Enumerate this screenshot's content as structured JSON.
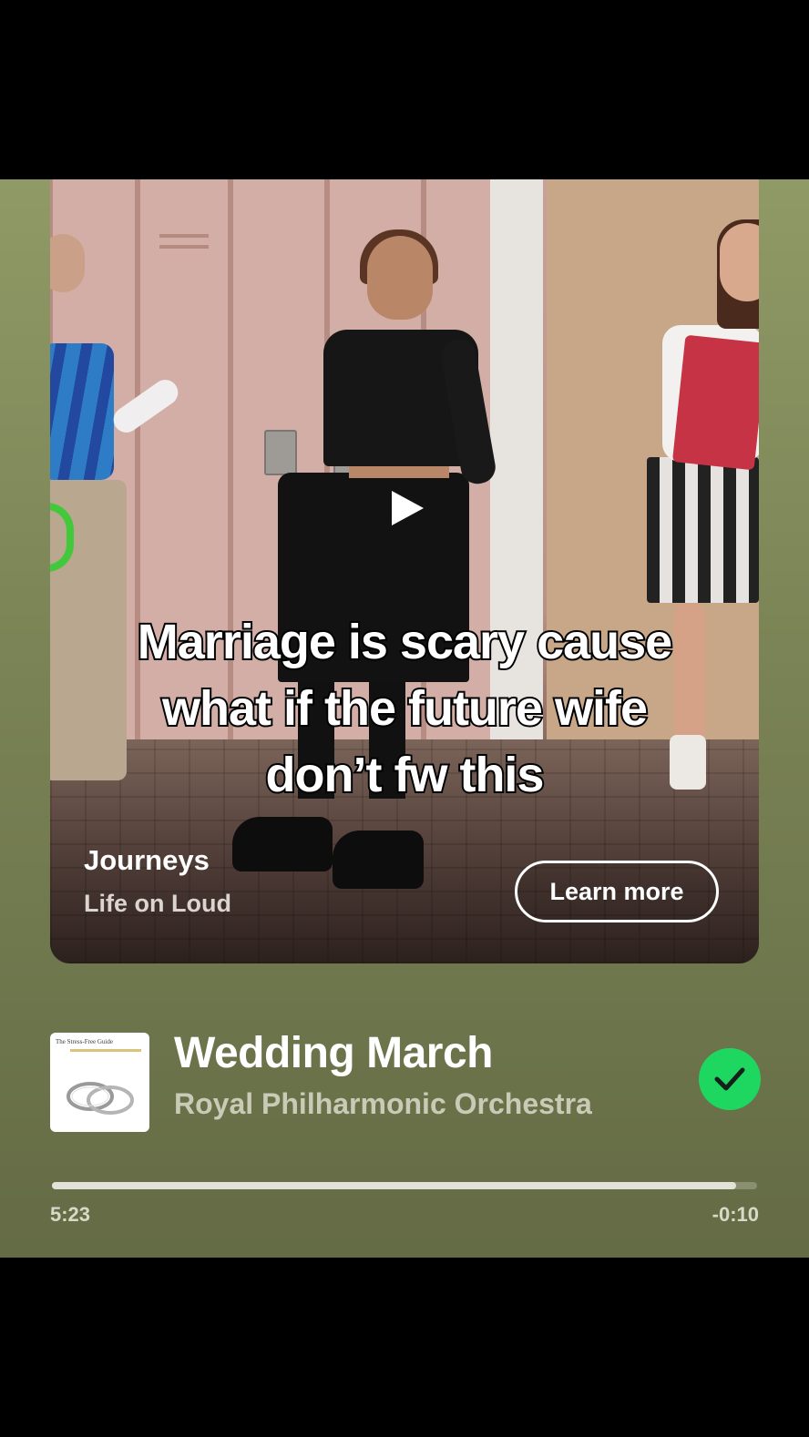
{
  "ad": {
    "caption_lines": [
      "Marriage is scary cause",
      "what if the future wife",
      "don’t fw this"
    ],
    "brand_name": "Journeys",
    "brand_tagline": "Life on Loud",
    "cta_label": "Learn more",
    "play_icon": "play-icon"
  },
  "track": {
    "album_art_text": "The Stress-Free Guide",
    "title": "Wedding March",
    "artist": "Royal Philharmonic Orchestra",
    "liked": true,
    "liked_icon": "checkmark-icon",
    "liked_color": "#1ed760"
  },
  "playback": {
    "elapsed": "5:23",
    "remaining": "-0:10",
    "progress_fraction": 0.97
  },
  "colors": {
    "background_top": "#8f9a66",
    "background_bottom": "#646b45"
  }
}
